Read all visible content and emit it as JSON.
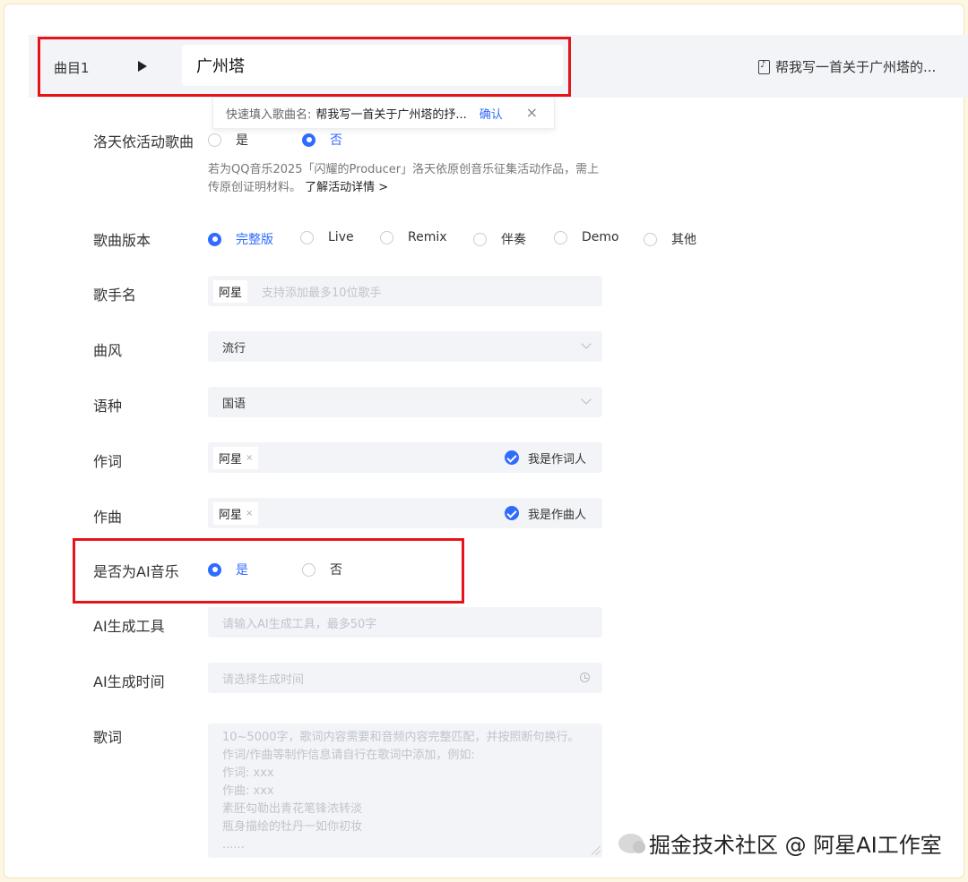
{
  "track": {
    "number_label": "曲目1",
    "title_value": "广州塔",
    "prompt_label": "帮我写一首关于广州塔的..."
  },
  "suggest": {
    "label": "快速填入歌曲名:",
    "value": "帮我写一首关于广州塔的抒...",
    "confirm": "确认",
    "close": "×"
  },
  "luotianyi": {
    "label": "洛天依活动歌曲",
    "options": [
      "是",
      "否"
    ],
    "selected": "否",
    "note": "若为QQ音乐2025「闪耀的Producer」洛天依原创音乐征集活动作品，需上传原创证明材料。",
    "more_link": "了解活动详情 >"
  },
  "version": {
    "label": "歌曲版本",
    "options": [
      "完整版",
      "Live",
      "Remix",
      "伴奏",
      "Demo",
      "其他"
    ],
    "selected": "完整版"
  },
  "singer": {
    "label": "歌手名",
    "tag": "阿星",
    "placeholder": "支持添加最多10位歌手"
  },
  "genre": {
    "label": "曲风",
    "value": "流行"
  },
  "language": {
    "label": "语种",
    "value": "国语"
  },
  "lyricist": {
    "label": "作词",
    "tag": "阿星",
    "remove": "×",
    "self_label": "我是作词人",
    "self_checked": true
  },
  "composer": {
    "label": "作曲",
    "tag": "阿星",
    "remove": "×",
    "self_label": "我是作曲人",
    "self_checked": true
  },
  "ai_music": {
    "label": "是否为AI音乐",
    "options": [
      "是",
      "否"
    ],
    "selected": "是"
  },
  "ai_tool": {
    "label": "AI生成工具",
    "placeholder": "请输入AI生成工具，最多50字"
  },
  "ai_time": {
    "label": "AI生成时间",
    "placeholder": "请选择生成时间"
  },
  "lyrics": {
    "label": "歌词",
    "placeholder_lines": [
      "10~5000字，歌词内容需要和音频内容完整匹配，并按照断句换行。",
      "作词/作曲等制作信息请自行在歌词中添加，例如:",
      "作词: xxx",
      "作曲: xxx",
      "素胚勾勒出青花笔锋浓转淡",
      "瓶身描绘的牡丹一如你初妆",
      "......"
    ]
  },
  "watermark": "掘金技术社区 @ 阿星AI工作室",
  "colors": {
    "accent": "#2f6bff",
    "highlight_box": "#e5141b",
    "field_bg": "#f2f4f7"
  }
}
